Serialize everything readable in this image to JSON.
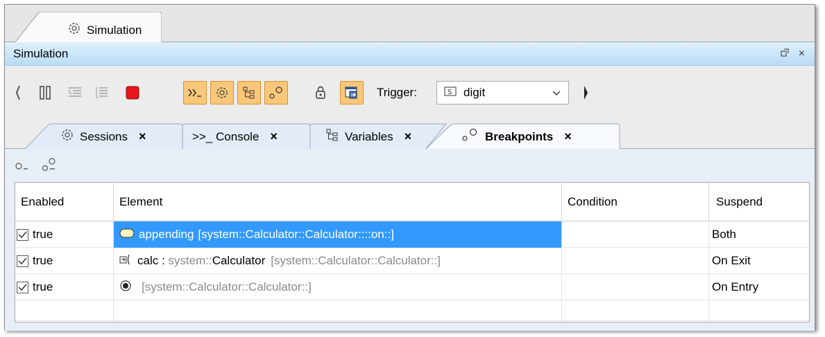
{
  "outer_tab": {
    "label": "Simulation",
    "icon": "gear-icon"
  },
  "view": {
    "title": "Simulation",
    "restore_icon": "restore-icon",
    "close_label": "×"
  },
  "toolbar": {
    "trigger_label": "Trigger:",
    "trigger_value": "digit",
    "active_accent": "#f9c77a"
  },
  "tabs": [
    {
      "label": "Sessions",
      "close": "×",
      "icon": "gear-icon"
    },
    {
      "label": ">>_ Console",
      "close": "×",
      "icon": "console-icon"
    },
    {
      "label": "Variables",
      "close": "×",
      "icon": "tree-icon"
    },
    {
      "label": "Breakpoints",
      "close": "×",
      "icon": "breakpoints-icon",
      "active": true
    }
  ],
  "table": {
    "headers": [
      "Enabled",
      "Element",
      "Condition",
      "Suspend"
    ],
    "rows": [
      {
        "enabled": "true",
        "element_name": "appending",
        "element_path": "[system::Calculator::Calculator::::on::]",
        "condition": "",
        "suspend": "Both",
        "selected": true
      },
      {
        "enabled": "true",
        "element_name": "calc : ",
        "element_type_prefix": "system::",
        "element_type": "Calculator",
        "element_path": "[system::Calculator::Calculator::]",
        "condition": "",
        "suspend": "On Exit"
      },
      {
        "enabled": "true",
        "element_name": "",
        "element_path": "[system::Calculator::Calculator::]",
        "condition": "",
        "suspend": "On Entry"
      }
    ]
  },
  "colors": {
    "selection": "#3399ff",
    "titlebar": "#c6e3f8"
  }
}
